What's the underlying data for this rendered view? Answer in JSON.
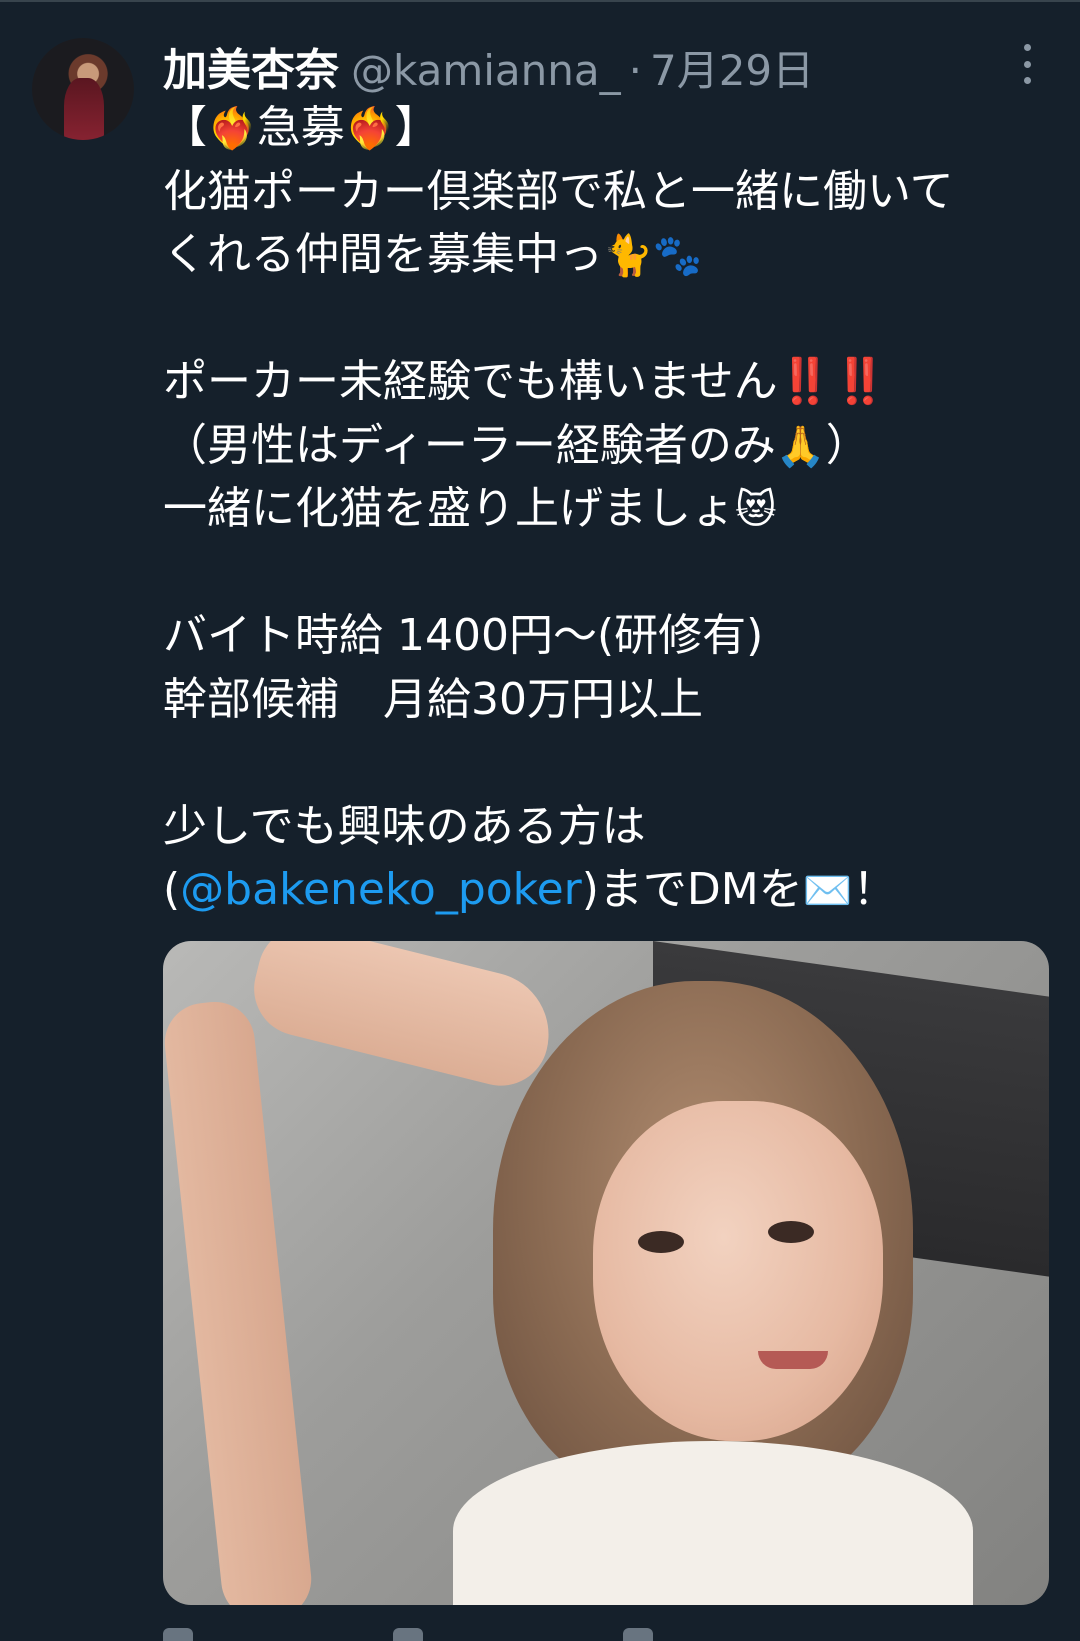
{
  "tweet": {
    "author_name": "加美杏奈",
    "author_handle": "@kamianna_",
    "separator": "·",
    "date": "7月29日",
    "lines": [
      {
        "type": "text",
        "parts": [
          {
            "t": "【"
          },
          {
            "t": "❤️‍🔥",
            "emoji": true
          },
          {
            "t": "急募"
          },
          {
            "t": "❤️‍🔥",
            "emoji": true
          },
          {
            "t": "】"
          }
        ]
      },
      {
        "type": "text",
        "parts": [
          {
            "t": "化猫ポーカー倶楽部で私と一緒に働いて"
          }
        ]
      },
      {
        "type": "text",
        "parts": [
          {
            "t": "くれる仲間を募集中っ"
          },
          {
            "t": "🐈🐾",
            "emoji": true
          }
        ]
      },
      {
        "type": "gap"
      },
      {
        "type": "text",
        "parts": [
          {
            "t": "ポーカー未経験でも構いません"
          },
          {
            "t": "‼️‼️",
            "red": true
          }
        ]
      },
      {
        "type": "text",
        "parts": [
          {
            "t": "（男性はディーラー経験者のみ"
          },
          {
            "t": "🙏",
            "emoji": true
          },
          {
            "t": "）"
          }
        ]
      },
      {
        "type": "text",
        "parts": [
          {
            "t": "一緒に化猫を盛り上げましょ"
          },
          {
            "t": "😻",
            "emoji": true
          }
        ]
      },
      {
        "type": "gap"
      },
      {
        "type": "text",
        "parts": [
          {
            "t": "バイト時給 1400円〜(研修有)"
          }
        ]
      },
      {
        "type": "text",
        "parts": [
          {
            "t": "幹部候補　月給30万円以上"
          }
        ]
      },
      {
        "type": "gap"
      },
      {
        "type": "text",
        "parts": [
          {
            "t": "少しでも興味のある方は"
          }
        ]
      },
      {
        "type": "text",
        "parts": [
          {
            "t": "("
          },
          {
            "t": "@bakeneko_poker",
            "mention": true
          },
          {
            "t": ")までDMを"
          },
          {
            "t": "✉️",
            "emoji": true
          },
          {
            "t": "！"
          }
        ]
      }
    ],
    "photo_alt": "photo",
    "icons": {
      "more": "more-icon"
    }
  }
}
